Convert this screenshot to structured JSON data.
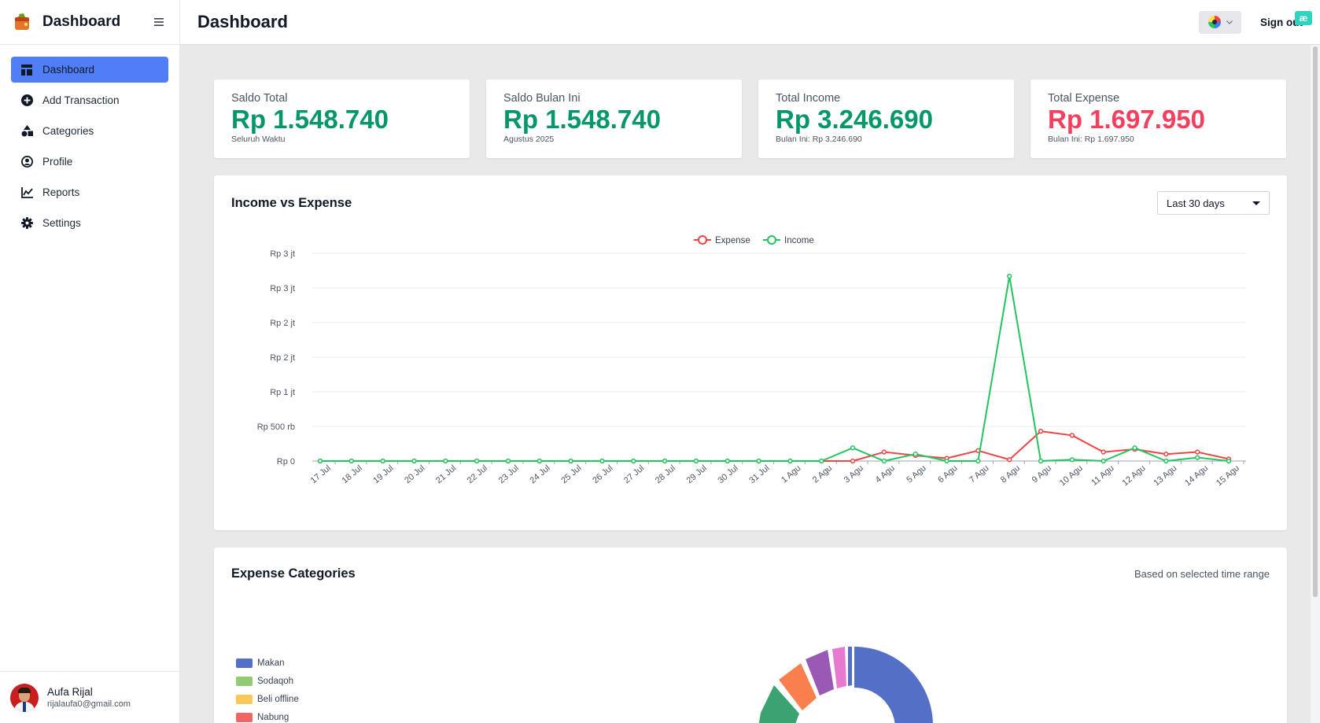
{
  "sidebar": {
    "brand": "Dashboard",
    "items": [
      {
        "label": "Dashboard",
        "icon": "dashboard-icon",
        "active": true
      },
      {
        "label": "Add Transaction",
        "icon": "plus-circle-icon"
      },
      {
        "label": "Categories",
        "icon": "shapes-icon"
      },
      {
        "label": "Profile",
        "icon": "user-circle-icon"
      },
      {
        "label": "Reports",
        "icon": "chart-line-icon"
      },
      {
        "label": "Settings",
        "icon": "gear-icon"
      }
    ],
    "user": {
      "name": "Aufa Rijal",
      "email": "rijalaufa0@gmail.com"
    }
  },
  "header": {
    "title": "Dashboard",
    "signout": "Sign out",
    "extension_badge": "æ"
  },
  "stats": [
    {
      "label": "Saldo Total",
      "value": "Rp 1.548.740",
      "sub": "Seluruh Waktu",
      "color": "#059669"
    },
    {
      "label": "Saldo Bulan Ini",
      "value": "Rp 1.548.740",
      "sub": "Agustus 2025",
      "color": "#059669"
    },
    {
      "label": "Total Income",
      "value": "Rp 3.246.690",
      "sub": "Bulan Ini: Rp 3.246.690",
      "color": "#059669"
    },
    {
      "label": "Total Expense",
      "value": "Rp 1.697.950",
      "sub": "Bulan Ini: Rp 1.697.950",
      "color": "#f43f5e"
    }
  ],
  "income_chart": {
    "title": "Income vs Expense",
    "range_selected": "Last 30 days"
  },
  "expense_categories": {
    "title": "Expense Categories",
    "note": "Based on selected time range",
    "legend": [
      {
        "label": "Makan",
        "color": "#5470c6"
      },
      {
        "label": "Sodaqoh",
        "color": "#91cc75"
      },
      {
        "label": "Beli offline",
        "color": "#fac858"
      },
      {
        "label": "Nabung",
        "color": "#ee6666"
      }
    ]
  },
  "chart_data": [
    {
      "type": "line",
      "title": "Income vs Expense",
      "x": [
        "17 Jul",
        "18 Jul",
        "19 Jul",
        "20 Jul",
        "21 Jul",
        "22 Jul",
        "23 Jul",
        "24 Jul",
        "25 Jul",
        "26 Jul",
        "27 Jul",
        "28 Jul",
        "29 Jul",
        "30 Jul",
        "31 Jul",
        "1 Agu",
        "2 Agu",
        "3 Agu",
        "4 Agu",
        "5 Agu",
        "6 Agu",
        "7 Agu",
        "8 Agu",
        "9 Agu",
        "10 Agu",
        "11 Agu",
        "12 Agu",
        "13 Agu",
        "14 Agu",
        "15 Agu"
      ],
      "y_ticks": [
        {
          "value": 0,
          "label": "Rp 0"
        },
        {
          "value": 500000,
          "label": "Rp 500 rb"
        },
        {
          "value": 1000000,
          "label": "Rp 1 jt"
        },
        {
          "value": 1500000,
          "label": "Rp 2 jt"
        },
        {
          "value": 2000000,
          "label": "Rp 2 jt"
        },
        {
          "value": 2500000,
          "label": "Rp 3 jt"
        },
        {
          "value": 3000000,
          "label": "Rp 3 jt"
        }
      ],
      "ylim": [
        0,
        3000000
      ],
      "legend_position": "top-center",
      "grid": true,
      "series": [
        {
          "name": "Expense",
          "color": "#ef4444",
          "values": [
            0,
            0,
            0,
            0,
            0,
            0,
            0,
            0,
            0,
            0,
            0,
            0,
            0,
            0,
            0,
            0,
            0,
            0,
            130000,
            80000,
            40000,
            150000,
            20000,
            430000,
            370000,
            130000,
            170000,
            100000,
            130000,
            30000
          ]
        },
        {
          "name": "Income",
          "color": "#22c55e",
          "values": [
            0,
            0,
            0,
            0,
            0,
            0,
            0,
            0,
            0,
            0,
            0,
            0,
            0,
            0,
            0,
            0,
            0,
            190000,
            0,
            100000,
            0,
            0,
            2670000,
            0,
            20000,
            0,
            190000,
            0,
            50000,
            0
          ]
        }
      ]
    },
    {
      "type": "pie",
      "title": "Expense Categories",
      "categories": [
        "Makan",
        "Sodaqoh",
        "Beli offline",
        "Nabung"
      ],
      "colors": [
        "#5470c6",
        "#91cc75",
        "#fac858",
        "#ee6666"
      ]
    }
  ]
}
